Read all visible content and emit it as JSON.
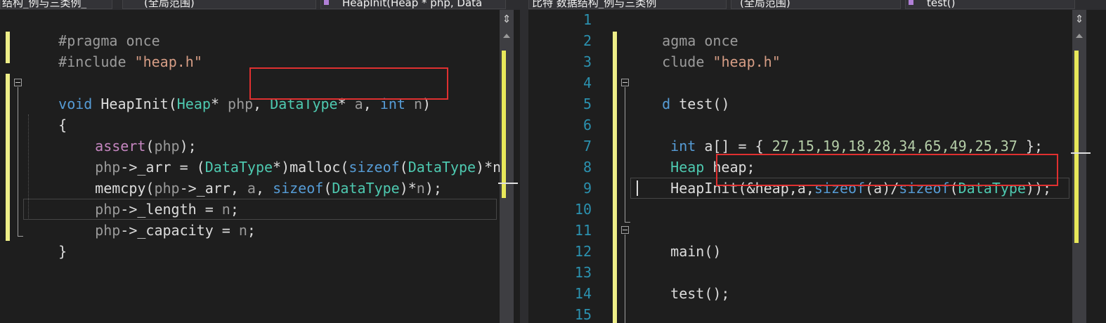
{
  "left_editor": {
    "nav": {
      "file_dropdown": "结构_例与三类例_",
      "scope_dropdown": "(全局范围)",
      "member_dropdown": "HeapInit(Heap * php, Data"
    },
    "lines": {
      "l1": "#pragma once",
      "l2_pp": "#include ",
      "l2_str": "\"heap.h\"",
      "l4_void": "void",
      "l4_name": " HeapInit(",
      "l4_heap": "Heap",
      "l4_a": "* ",
      "l4_php": "php",
      "l4_b": ", ",
      "l4_dt": "DataType",
      "l4_c": "* ",
      "l4_pa": "a",
      "l4_d": ", ",
      "l4_int": "int",
      "l4_e": " ",
      "l4_pn": "n",
      "l4_f": ")",
      "l5": "{",
      "l6_assert": "assert",
      "l6_a": "(",
      "l6_php": "php",
      "l6_b": ");",
      "l7_php": "php",
      "l7_a": "->_arr = (",
      "l7_dt": "DataType",
      "l7_b": "*)malloc(",
      "l7_sizeof": "sizeof",
      "l7_c": "(",
      "l7_dt2": "DataType",
      "l7_d": ")*n",
      "l8_a": "memcpy(",
      "l8_php": "php",
      "l8_b": "->_arr, ",
      "l8_pa": "a",
      "l8_c": ", ",
      "l8_sizeof": "sizeof",
      "l8_d": "(",
      "l8_dt": "DataType",
      "l8_e": ")*",
      "l8_pn": "n",
      "l8_f": ");",
      "l9_php": "php",
      "l9_a": "->_length = ",
      "l9_pn": "n",
      "l9_b": ";",
      "l10_php": "php",
      "l10_a": "->_capacity = ",
      "l10_pn": "n",
      "l10_b": ";",
      "l11": "}"
    }
  },
  "right_editor": {
    "nav": {
      "file_dropdown": "比特 数据结构_例与三类例",
      "scope_dropdown": "(全局范围)",
      "member_dropdown": "test()"
    },
    "line_numbers": [
      "1",
      "2",
      "3",
      "4",
      "5",
      "6",
      "7",
      "8",
      "9",
      "10",
      "11",
      "12",
      "13",
      "14",
      "15"
    ],
    "lines": {
      "l1": "agma once",
      "l2_pp": "clude ",
      "l2_str": "\"heap.h\"",
      "l4_a": "d",
      "l4_b": " test()",
      "l6_int": "int",
      "l6_a": " a[] = { ",
      "l6_nums": "27,15,19,18,28,34,65,49,25,37",
      "l6_b": " };",
      "l7_heap": "Heap",
      "l7_a": " heap;",
      "l8_a": "HeapInit(&heap,a,",
      "l8_sizeof": "sizeof",
      "l8_b": "(a)/",
      "l8_sizeof2": "sizeof",
      "l8_c": "(",
      "l8_dt": "DataType",
      "l8_d": "));",
      "l11": "main()",
      "l13": "test();"
    }
  },
  "icons": [
    "split-editor-icon",
    "scroll-up-icon",
    "collapse-icon",
    "code-member-icon"
  ],
  "colors": {
    "editor_bg": "#1e1e1e",
    "keyword": "#569cd6",
    "type": "#4ec9b0",
    "string": "#d69d85",
    "number": "#b5cea8",
    "macro": "#c586c0",
    "param": "#9a9a9a",
    "line_number": "#2b91af",
    "highlight_box": "#e03030",
    "change_bar": "#eeee88"
  }
}
